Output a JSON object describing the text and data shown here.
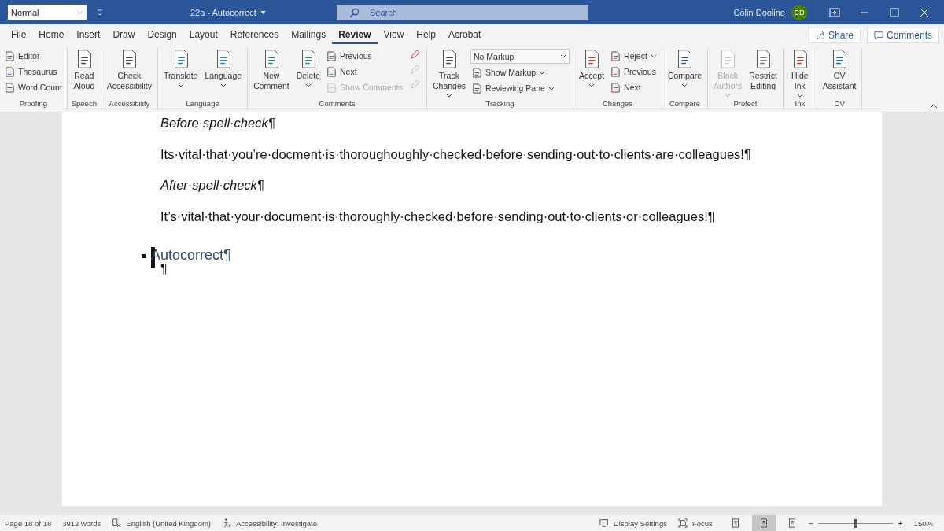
{
  "title_bar": {
    "style_box": "Normal",
    "document_title": "22a - Autocorrect",
    "search": {
      "placeholder": "Search"
    },
    "user_name": "Colin Dooling",
    "avatar_initials": "CD"
  },
  "menu_tabs": [
    {
      "label": "File",
      "selected": false
    },
    {
      "label": "Home",
      "selected": false
    },
    {
      "label": "Insert",
      "selected": false
    },
    {
      "label": "Draw",
      "selected": false
    },
    {
      "label": "Design",
      "selected": false
    },
    {
      "label": "Layout",
      "selected": false
    },
    {
      "label": "References",
      "selected": false
    },
    {
      "label": "Mailings",
      "selected": false
    },
    {
      "label": "Review",
      "selected": true
    },
    {
      "label": "View",
      "selected": false
    },
    {
      "label": "Help",
      "selected": false
    },
    {
      "label": "Acrobat",
      "selected": false
    }
  ],
  "share_button": "Share",
  "comments_button": "Comments",
  "ribbon_groups": [
    {
      "label": "Proofing",
      "items": [
        {
          "kind": "small",
          "lines": [
            "Editor"
          ],
          "caret": false,
          "disabled": false
        },
        {
          "kind": "small",
          "lines": [
            "Thesaurus"
          ],
          "caret": false,
          "disabled": false
        },
        {
          "kind": "small",
          "lines": [
            "Word Count"
          ],
          "caret": false,
          "disabled": false
        }
      ]
    },
    {
      "label": "Speech",
      "items": [
        {
          "kind": "large",
          "lines": [
            "Read",
            "Aloud"
          ],
          "caret": false,
          "disabled": false
        }
      ]
    },
    {
      "label": "Accessibility",
      "items": [
        {
          "kind": "large",
          "lines": [
            "Check",
            "Accessibility"
          ],
          "caret": false,
          "disabled": false
        }
      ]
    },
    {
      "label": "Language",
      "items": [
        {
          "kind": "large",
          "lines": [
            "Translate"
          ],
          "caret": true,
          "disabled": false
        },
        {
          "kind": "large",
          "lines": [
            "Language"
          ],
          "caret": true,
          "disabled": false
        }
      ]
    },
    {
      "label": "Comments",
      "items": [
        {
          "kind": "large",
          "lines": [
            "New",
            "Comment"
          ],
          "caret": false,
          "disabled": false
        },
        {
          "kind": "large",
          "lines": [
            "Delete"
          ],
          "caret": true,
          "disabled": false
        },
        {
          "kind": "small",
          "lines": [
            "Previous"
          ],
          "caret": false,
          "disabled": false
        },
        {
          "kind": "small",
          "lines": [
            "Next"
          ],
          "caret": false,
          "disabled": false
        },
        {
          "kind": "small",
          "lines": [
            "Show Comments"
          ],
          "caret": false,
          "disabled": true
        },
        {
          "kind": "icon",
          "caret": false,
          "disabled": false
        },
        {
          "kind": "icon",
          "caret": false,
          "disabled": true
        },
        {
          "kind": "icon",
          "caret": false,
          "disabled": true
        }
      ]
    },
    {
      "label": "Tracking",
      "items": [
        {
          "kind": "large",
          "lines": [
            "Track",
            "Changes"
          ],
          "caret": true,
          "disabled": false
        },
        {
          "kind": "select",
          "lines": [
            "No Markup"
          ],
          "caret": true,
          "disabled": false
        },
        {
          "kind": "small",
          "lines": [
            "Show Markup"
          ],
          "caret": true,
          "disabled": false
        },
        {
          "kind": "small",
          "lines": [
            "Reviewing Pane"
          ],
          "caret": true,
          "disabled": false
        }
      ]
    },
    {
      "label": "Changes",
      "items": [
        {
          "kind": "large",
          "lines": [
            "Accept"
          ],
          "caret": true,
          "disabled": false
        },
        {
          "kind": "small",
          "lines": [
            "Reject"
          ],
          "caret": true,
          "disabled": false
        },
        {
          "kind": "small",
          "lines": [
            "Previous"
          ],
          "caret": false,
          "disabled": false
        },
        {
          "kind": "small",
          "lines": [
            "Next"
          ],
          "caret": false,
          "disabled": false
        }
      ]
    },
    {
      "label": "Compare",
      "items": [
        {
          "kind": "large",
          "lines": [
            "Compare"
          ],
          "caret": true,
          "disabled": false
        }
      ]
    },
    {
      "label": "Protect",
      "items": [
        {
          "kind": "large",
          "lines": [
            "Block",
            "Authors"
          ],
          "caret": true,
          "disabled": true
        },
        {
          "kind": "large",
          "lines": [
            "Restrict",
            "Editing"
          ],
          "caret": false,
          "disabled": false
        }
      ]
    },
    {
      "label": "Ink",
      "items": [
        {
          "kind": "large",
          "lines": [
            "Hide",
            "Ink"
          ],
          "caret": true,
          "disabled": false
        }
      ]
    },
    {
      "label": "CV",
      "items": [
        {
          "kind": "large",
          "lines": [
            "CV",
            "Assistant"
          ],
          "caret": false,
          "disabled": false
        }
      ]
    }
  ],
  "document": [
    {
      "kind": "heading",
      "text": "Before·spell·check¶"
    },
    {
      "kind": "body",
      "text": "Its·vital·that·you’re·docment·is·thoroughoughly·checked·before·sending·out·to·clients·are·colleagues!¶"
    },
    {
      "kind": "heading",
      "text": "After·spell·check¶"
    },
    {
      "kind": "body",
      "text": "It’s·vital·that·your·document·is·thoroughly·checked·before·sending·out·to·clients·or·colleagues!¶"
    },
    {
      "kind": "bullet",
      "text": "Autocorrect¶"
    },
    {
      "kind": "empty",
      "text": "¶"
    }
  ],
  "status_bar": {
    "page": "Page 18 of 18",
    "words": "3912 words",
    "language": "English (United Kingdom)",
    "accessibility": "Accessibility: Investigate",
    "display_settings": "Display Settings",
    "focus": "Focus",
    "views": [
      {
        "selected": false
      },
      {
        "selected": true
      },
      {
        "selected": false
      }
    ],
    "zoom_out": "−",
    "zoom_in": "+",
    "zoom": {
      "level": 0.5
    },
    "zoom_percent": "150%"
  }
}
